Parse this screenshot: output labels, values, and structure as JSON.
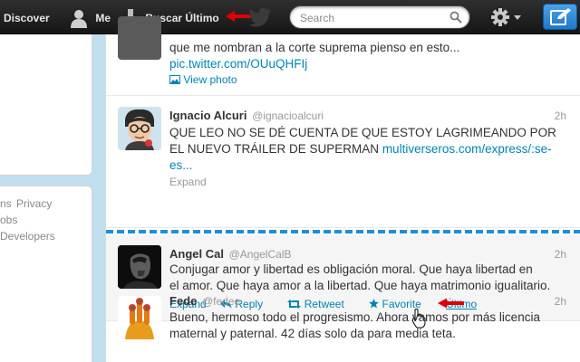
{
  "nav": {
    "discover": "Discover",
    "me": "Me",
    "buscar": "Buscar Último"
  },
  "search": {
    "placeholder": "Search",
    "value": ""
  },
  "footer_links": [
    "ns",
    "Privacy",
    "obs",
    "Developers"
  ],
  "tweets": [
    {
      "line1": "que me nombran a la corte suprema pienso en esto...",
      "link": "pic.twitter.com/OUuQHFIj",
      "view_photo": "View photo"
    },
    {
      "name": "Ignacio Alcuri",
      "handle": "@ignacioalcuri",
      "time": "2h",
      "line1": "QUE LEO NO SE DÉ CUENTA DE QUE ESTOY LAGRIMEANDO POR",
      "line2": "EL NUEVO TRÁILER DE SUPERMAN ",
      "link_part1": "multiverseros.com/express/:se-",
      "link_part2": "es...",
      "expand": "Expand"
    },
    {
      "name": "Angel Cal",
      "handle": "@AngelCalB",
      "time": "2h",
      "line1": "Conjugar amor y libertad es obligación moral. Que haya libertad en",
      "line2": "el amor. Que haya amor a la libertad. Que haya matrimonio igualitario.",
      "expand": "Expand",
      "reply": "Reply",
      "retweet": "Retweet",
      "favorite": "Favorite",
      "ultimo": "Último"
    },
    {
      "name": "Fede",
      "handle": "@fedee",
      "time": "2h",
      "line1": "Bueno, hermoso todo el progresismo. Ahora vamos por más licencia",
      "line2": "maternal y paternal. 42 días solo da para media teta."
    }
  ],
  "colors": {
    "link": "#0084b4",
    "separator": "#1d8fd6",
    "annotation_arrow": "#e00000"
  }
}
